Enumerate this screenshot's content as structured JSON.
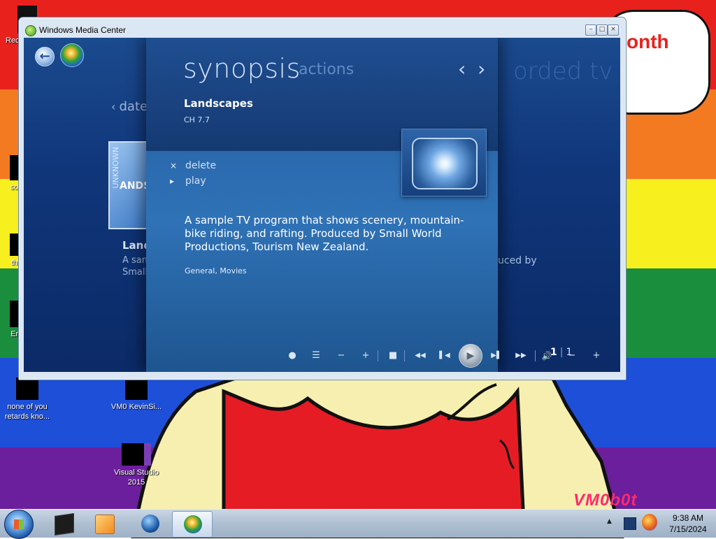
{
  "colors": {
    "wmc_accent": "#2f72b6",
    "wmc_dark": "#10367a",
    "desktop_red": "#e8211c",
    "watermark": "#ff2a6e"
  },
  "desktop": {
    "cloud_text": "onth",
    "watermark": "VM0b0t",
    "icons": [
      {
        "label": "Rec",
        "icon": "shortcut-icon"
      },
      {
        "label": "som",
        "icon": "shortcut-icon"
      },
      {
        "label": "that",
        "icon": "shortcut-icon"
      },
      {
        "label": "End",
        "icon": "shortcut-icon"
      },
      {
        "label": "none of you retards kno...",
        "icon": "shortcut-icon"
      },
      {
        "label": "VM0 KevinSi...",
        "icon": "shortcut-icon"
      },
      {
        "label": "Visual Studio 2015",
        "icon": "visual-studio-icon"
      }
    ]
  },
  "window": {
    "title": "Windows Media Center",
    "minimize": "–",
    "maximize": "□",
    "close": "×"
  },
  "wmc": {
    "background": {
      "date_label": "date",
      "section_title": "orded tv",
      "thumb_vertical": "UNKNOWN",
      "thumb_label": "ANDS",
      "item_title": "Land",
      "item_line1": "A sam",
      "item_line2": "Small",
      "side_text": "uced by"
    },
    "tabs": {
      "active": "synopsis",
      "inactive": "actions"
    },
    "nav_arrows": "‹ ›",
    "program": {
      "title": "Landscapes",
      "channel": "CH 7.7",
      "description": "A sample TV program that shows scenery, mountain-bike riding, and rafting. Produced by Small World Productions, Tourism New Zealand.",
      "genre": "General, Movies"
    },
    "actions": [
      {
        "mark": "×",
        "label": "delete"
      },
      {
        "mark": "▸",
        "label": "play"
      }
    ],
    "pager": {
      "current": "1",
      "separator": "|",
      "total": "1"
    },
    "transport": {
      "record": "●",
      "guide": "☰",
      "ch_down": "−",
      "ch_up": "+",
      "stop": "■",
      "rewind": "◀◀",
      "prev": "▌◀",
      "play": "▶",
      "next": "▶▌",
      "ffwd": "▶▶",
      "volume": "🔊",
      "vol_down": "−",
      "vol_up": "+"
    }
  },
  "taskbar": {
    "apps": [
      {
        "name": "app-black-box",
        "icon": "black-box-icon"
      },
      {
        "name": "windows-media-player",
        "icon": "media-player-icon"
      },
      {
        "name": "app-globe",
        "icon": "globe-icon"
      },
      {
        "name": "windows-media-center",
        "icon": "media-center-icon",
        "active": true
      }
    ],
    "clock": {
      "time": "9:38 AM",
      "date": "7/15/2024"
    },
    "tray_arrow": "▲"
  }
}
